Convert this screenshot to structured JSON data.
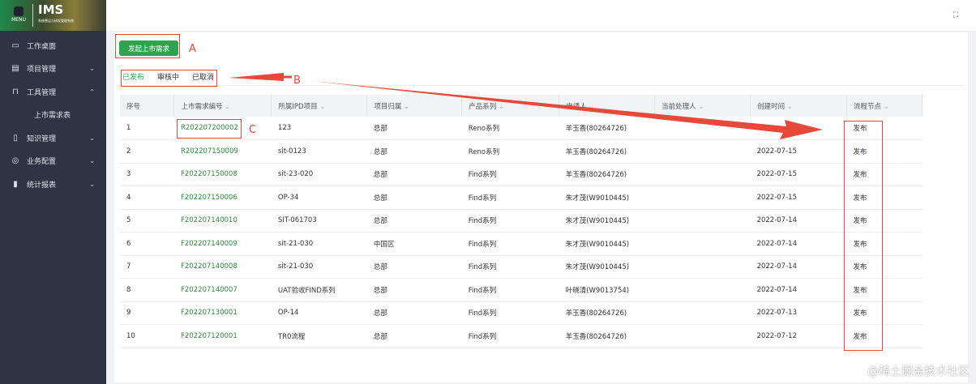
{
  "sidebar": {
    "logo_title": "IMS",
    "logo_menu": "MENU",
    "logo_subtitle": "系统营运与研发管理系统",
    "items": [
      {
        "icon": "monitor-icon",
        "label": "工作桌面",
        "chevron": ""
      },
      {
        "icon": "folder-icon",
        "label": "项目管理",
        "chevron": "⌄"
      },
      {
        "icon": "briefcase-icon",
        "label": "工具管理",
        "chevron": "⌃"
      },
      {
        "icon": "",
        "label": "上市需求表",
        "chevron": ""
      },
      {
        "icon": "book-icon",
        "label": "知识管理",
        "chevron": "⌄"
      },
      {
        "icon": "settings-icon",
        "label": "业务配置",
        "chevron": "⌄"
      },
      {
        "icon": "bar-chart-icon",
        "label": "统计报表",
        "chevron": "⌄"
      }
    ]
  },
  "toolbar": {
    "create_label": "发起上市需求",
    "fullscreen_icon": "fullscreen-icon"
  },
  "tabs": [
    {
      "label": "已发布",
      "active": true
    },
    {
      "label": "审核中"
    },
    {
      "label": "已取消"
    }
  ],
  "table": {
    "headers": [
      "序号",
      "上市需求编号",
      "所属IPD项目",
      "项目归属",
      "产品系列",
      "申请人",
      "当前处理人",
      "创建时间",
      "流程节点"
    ],
    "rows": [
      [
        "1",
        "R202207200002",
        "123",
        "总部",
        "Reno系列",
        "羊玉香(80264726)",
        "",
        "",
        "发布"
      ],
      [
        "2",
        "R202207150009",
        "sit-0123",
        "总部",
        "Reno系列",
        "羊玉香(80264726)",
        "",
        "2022-07-15",
        "发布"
      ],
      [
        "3",
        "F202207150008",
        "sit-23-020",
        "总部",
        "Find系列",
        "羊玉香(80264726)",
        "",
        "2022-07-15",
        "发布"
      ],
      [
        "4",
        "F202207150006",
        "OP-34",
        "总部",
        "Find系列",
        "朱才茂(W9010445)",
        "",
        "2022-07-15",
        "发布"
      ],
      [
        "5",
        "F202207140010",
        "SIT-061703",
        "总部",
        "Find系列",
        "朱才茂(W9010445)",
        "",
        "2022-07-14",
        "发布"
      ],
      [
        "6",
        "F202207140009",
        "sit-21-030",
        "中国区",
        "Find系列",
        "朱才茂(W9010445)",
        "",
        "2022-07-14",
        "发布"
      ],
      [
        "7",
        "F202207140008",
        "sit-21-030",
        "总部",
        "Find系列",
        "朱才茂(W9010445)",
        "",
        "2022-07-14",
        "发布"
      ],
      [
        "8",
        "F202207140007",
        "UAT验收FIND系列",
        "总部",
        "Find系列",
        "叶晓清(W9013754)",
        "",
        "2022-07-14",
        "发布"
      ],
      [
        "9",
        "F202207130001",
        "OP-14",
        "总部",
        "Find系列",
        "羊玉香(80264726)",
        "",
        "2022-07-13",
        "发布"
      ],
      [
        "10",
        "F202207120001",
        "TR0流程",
        "总部",
        "Find系列",
        "羊玉香(80264726)",
        "",
        "2022-07-12",
        "发布"
      ]
    ]
  },
  "annotations": {
    "a": "A",
    "b": "B",
    "c": "C",
    "color": "#e8483a"
  },
  "watermark": "@稀土掘金技术社区",
  "colors": {
    "accent": "#2ea44f",
    "sidebar": "#2d3543"
  }
}
